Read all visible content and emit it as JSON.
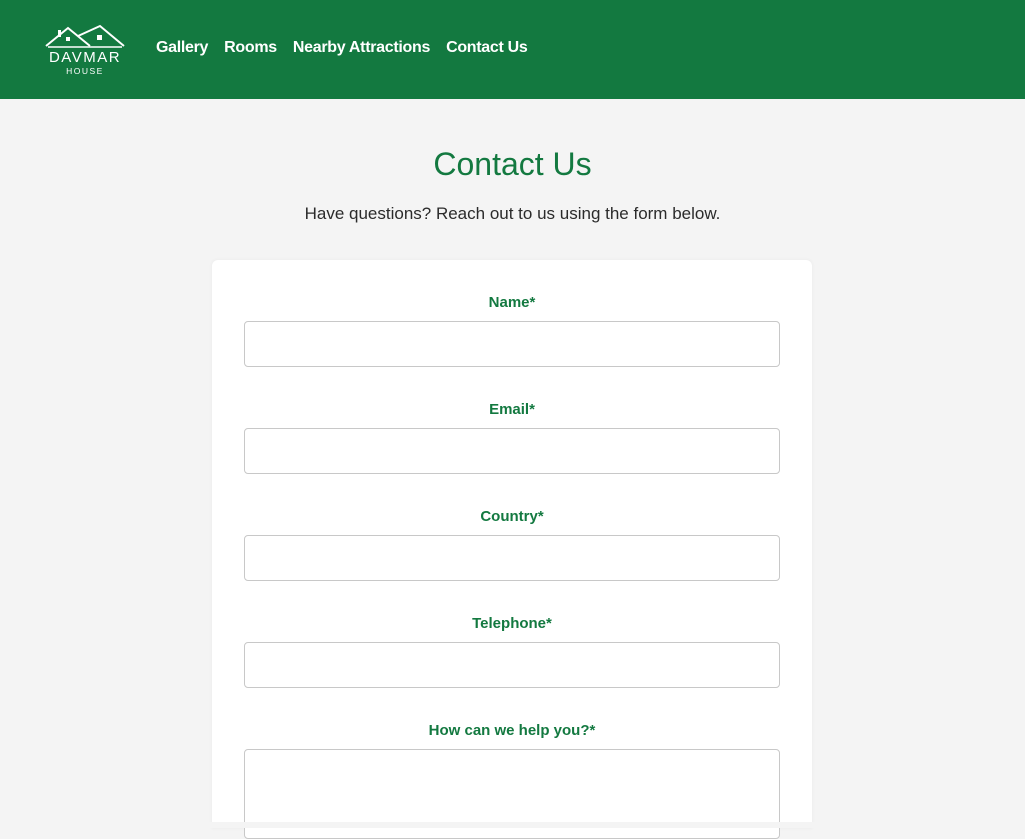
{
  "header": {
    "logo": {
      "main": "DAVMAR",
      "sub": "HOUSE",
      "icon": "house-roof-icon"
    },
    "nav": [
      "Gallery",
      "Rooms",
      "Nearby Attractions",
      "Contact Us"
    ]
  },
  "main": {
    "title": "Contact Us",
    "subtitle": "Have questions? Reach out to us using the form below."
  },
  "form": {
    "fields": [
      {
        "label": "Name*",
        "value": ""
      },
      {
        "label": "Email*",
        "value": ""
      },
      {
        "label": "Country*",
        "value": ""
      },
      {
        "label": "Telephone*",
        "value": ""
      },
      {
        "label": "How can we help you?*",
        "value": ""
      }
    ]
  },
  "colors": {
    "brand_green": "#137940",
    "page_background": "#f4f4f4",
    "card_background": "#ffffff",
    "input_border": "#c8c8c8"
  }
}
